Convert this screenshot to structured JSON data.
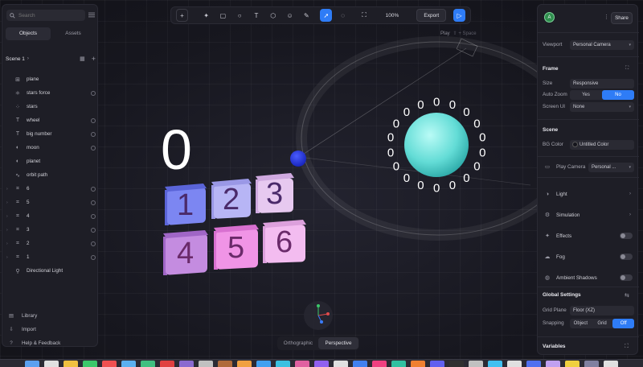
{
  "left_panel": {
    "search": {
      "placeholder": "Search"
    },
    "tabs": [
      {
        "label": "Objects",
        "active": true
      },
      {
        "label": "Assets",
        "active": false
      }
    ],
    "scene": {
      "label": "Scene 1"
    },
    "tree": [
      {
        "label": "plane",
        "icon": "grid-icon"
      },
      {
        "label": "stars force",
        "icon": "force-icon"
      },
      {
        "label": "stars",
        "icon": "particles-icon"
      },
      {
        "label": "wheel",
        "icon": "text-icon"
      },
      {
        "label": "big number",
        "icon": "text-icon"
      },
      {
        "label": "moon",
        "icon": "sphere-icon"
      },
      {
        "label": "planet",
        "icon": "sphere-icon"
      },
      {
        "label": "orbit path",
        "icon": "path-icon"
      },
      {
        "label": "6",
        "icon": "group-icon"
      },
      {
        "label": "5",
        "icon": "group-icon"
      },
      {
        "label": "4",
        "icon": "group-icon"
      },
      {
        "label": "3",
        "icon": "group-icon"
      },
      {
        "label": "2",
        "icon": "group-icon"
      },
      {
        "label": "1",
        "icon": "group-icon"
      },
      {
        "label": "Directional Light",
        "icon": "light-icon"
      }
    ],
    "bottom": [
      {
        "label": "Library",
        "icon": "library-icon"
      },
      {
        "label": "Import",
        "icon": "import-icon"
      },
      {
        "label": "Help & Feedback",
        "icon": "help-icon"
      }
    ]
  },
  "toolbar": {
    "zoom": "100%",
    "export_label": "Export",
    "play_hint": "Play",
    "play_shortcut": "⇧ + Space"
  },
  "right_panel": {
    "avatar_letter": "A",
    "share_label": "Share",
    "viewport": {
      "label": "Viewport",
      "value": "Personal Camera"
    },
    "frame": {
      "title": "Frame",
      "size": {
        "label": "Size",
        "value": "Responsive"
      },
      "auto_zoom": {
        "label": "Auto Zoom",
        "options": [
          "Yes",
          "No"
        ],
        "selected": "No"
      },
      "screen_ui": {
        "label": "Screen UI",
        "value": "None"
      }
    },
    "scene": {
      "title": "Scene",
      "bg_color": {
        "label": "BG Color",
        "value": "Untitled Color"
      },
      "play_camera": {
        "label": "Play Camera",
        "value": "Personal ..."
      },
      "items": [
        {
          "label": "Light",
          "kind": "arrow"
        },
        {
          "label": "Simulation",
          "kind": "arrow"
        },
        {
          "label": "Effects",
          "kind": "toggle"
        },
        {
          "label": "Fog",
          "kind": "toggle"
        },
        {
          "label": "Ambient Shadows",
          "kind": "toggle"
        }
      ]
    },
    "global": {
      "title": "Global Settings",
      "grid_plane": {
        "label": "Grid Plane",
        "value": "Floor (XZ)"
      },
      "snapping": {
        "label": "Snapping",
        "options": [
          "Object",
          "Grid",
          "Off"
        ],
        "selected": "Off"
      }
    },
    "variables_title": "Variables"
  },
  "canvas": {
    "big_number": "0",
    "wheel_digit": "0",
    "cubes": [
      "1",
      "2",
      "3",
      "4",
      "5",
      "6"
    ],
    "colors": {
      "planet": "#6fe0e0",
      "moon": "#2233dd",
      "accent": "#2e7cf6"
    }
  },
  "view_toggle": {
    "options": [
      "Orthographic",
      "Perspective"
    ],
    "selected": "Perspective"
  }
}
